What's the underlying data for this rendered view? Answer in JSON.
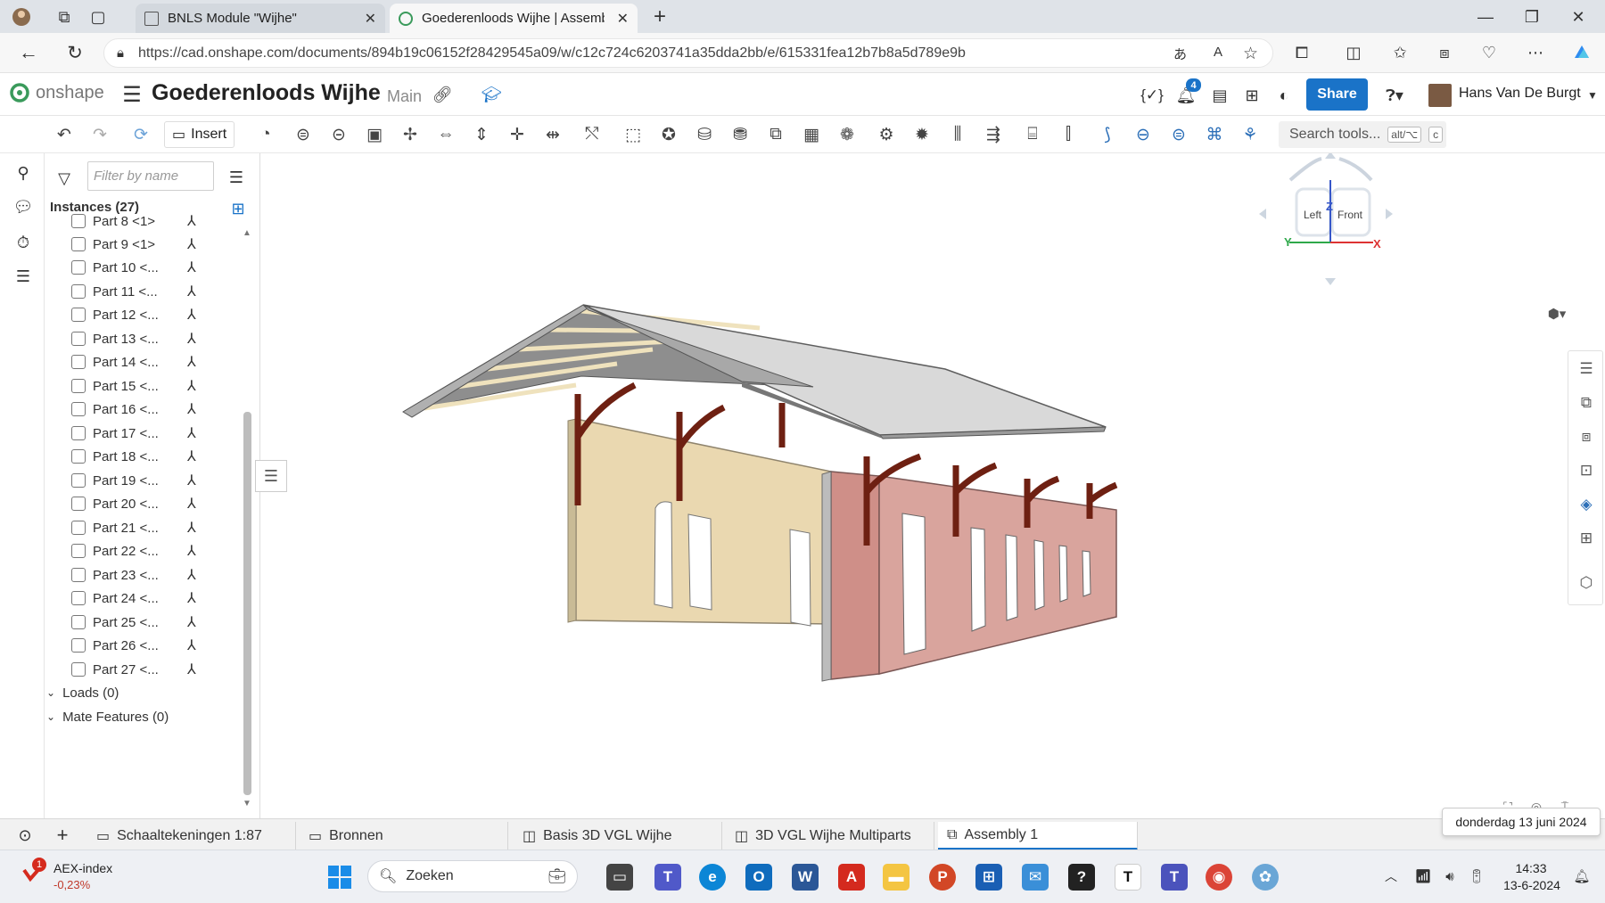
{
  "browser": {
    "tabs": [
      {
        "title": "BNLS Module \"Wijhe\"",
        "active": false
      },
      {
        "title": "Goederenloods Wijhe | Assembly",
        "active": true
      }
    ],
    "url": "https://cad.onshape.com/documents/894b19c06152f28429545a09/w/c12c724c6203741a35dda2bb/e/615331fea12b7b8a5d789e9b"
  },
  "app": {
    "logo_text": "onshape",
    "document_title": "Goederenloods Wijhe",
    "branch": "Main",
    "notification_count": "4",
    "share_label": "Share",
    "user_name": "Hans Van De Burgt",
    "accent_color": "#1a73c8"
  },
  "toolbar": {
    "insert_label": "Insert",
    "search_placeholder": "Search tools...",
    "search_shortcut": "alt/⌥",
    "search_shortcut_key": "c"
  },
  "panel": {
    "filter_placeholder": "Filter by name",
    "instances_header": "Instances (27)",
    "parts": [
      "Part 8 <1>",
      "Part 9 <1>",
      "Part 10 <...",
      "Part 11 <...",
      "Part 12 <...",
      "Part 13 <...",
      "Part 14 <...",
      "Part 15 <...",
      "Part 16 <...",
      "Part 17 <...",
      "Part 18 <...",
      "Part 19 <...",
      "Part 20 <...",
      "Part 21 <...",
      "Part 22 <...",
      "Part 23 <...",
      "Part 24 <...",
      "Part 25 <...",
      "Part 26 <...",
      "Part 27 <..."
    ],
    "loads_label": "Loads (0)",
    "mates_label": "Mate Features (0)"
  },
  "viewcube": {
    "z_label": "Z",
    "y_label": "Y",
    "x_label": "X",
    "left_face": "Left",
    "front_face": "Front"
  },
  "doc_tabs": [
    {
      "label": "Schaaltekeningen 1:87",
      "active": false
    },
    {
      "label": "Bronnen",
      "active": false
    },
    {
      "label": "Basis 3D VGL Wijhe",
      "active": false
    },
    {
      "label": "3D VGL Wijhe Multiparts",
      "active": false
    },
    {
      "label": "Assembly 1",
      "active": true
    }
  ],
  "tooltip_date": "donderdag 13 juni 2024",
  "taskbar": {
    "stock_name": "AEX-index",
    "stock_change": "-0,23%",
    "stock_badge": "1",
    "search_label": "Zoeken",
    "time": "14:33",
    "date": "13-6-2024"
  }
}
